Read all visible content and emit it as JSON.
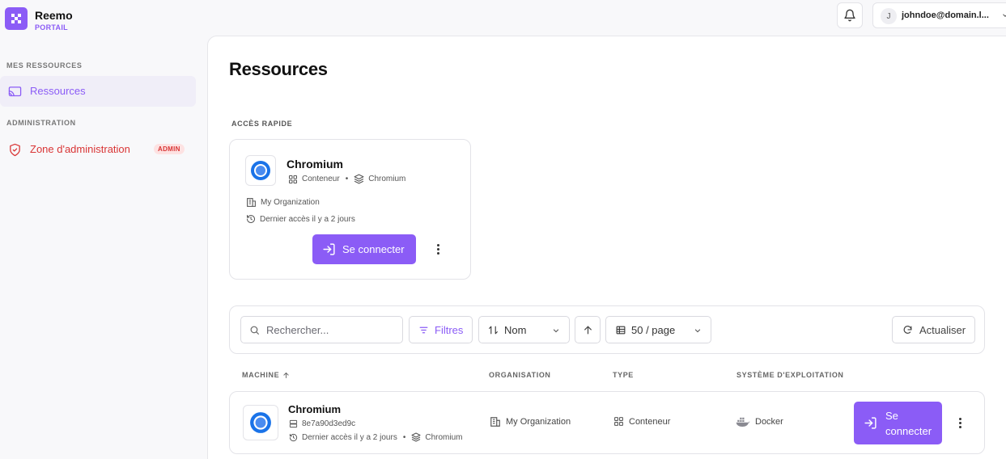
{
  "brand": {
    "name": "Reemo",
    "subtitle": "PORTAIL"
  },
  "header": {
    "user_initial": "J",
    "user_email": "johndoe@domain.l..."
  },
  "sidebar": {
    "sections": [
      {
        "title": "MES RESSOURCES",
        "items": [
          {
            "label": "Ressources",
            "active": true
          }
        ]
      },
      {
        "title": "ADMINISTRATION",
        "items": [
          {
            "label": "Zone d'administration",
            "badge": "ADMIN"
          }
        ]
      }
    ]
  },
  "page": {
    "title": "Ressources"
  },
  "quick_access": {
    "label": "ACCÈS RAPIDE",
    "card": {
      "name": "Chromium",
      "type": "Conteneur",
      "image": "Chromium",
      "organization": "My Organization",
      "last_access": "Dernier accès il y a 2 jours",
      "connect_label": "Se connecter"
    }
  },
  "toolbar": {
    "search_placeholder": "Rechercher...",
    "filters_label": "Filtres",
    "sort_label": "Nom",
    "page_size_label": "50 / page",
    "refresh_label": "Actualiser"
  },
  "table": {
    "columns": [
      "MACHINE",
      "ORGANISATION",
      "TYPE",
      "SYSTÈME D'EXPLOITATION"
    ],
    "rows": [
      {
        "name": "Chromium",
        "id": "8e7a90d3ed9c",
        "last_access": "Dernier accès il y a 2 jours",
        "image": "Chromium",
        "organization": "My Organization",
        "type": "Conteneur",
        "os": "Docker",
        "connect_line1": "Se",
        "connect_line2": "connecter"
      }
    ]
  },
  "colors": {
    "accent": "#8b5cf6",
    "danger": "#d93535",
    "chromium_blue": "#1a73e8"
  }
}
